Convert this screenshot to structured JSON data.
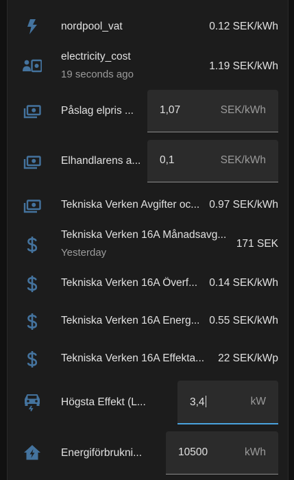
{
  "colors": {
    "background": "#111111",
    "card": "#1c1c1c",
    "icon": "#44739e",
    "field": "#2b2b2b",
    "accent": "#4aa3df"
  },
  "entities": [
    {
      "icon": "lightning-bolt-icon",
      "name": "nordpool_vat",
      "state": "0.12 SEK/kWh"
    },
    {
      "icon": "cash-user-icon",
      "name": "electricity_cost",
      "secondary": "19 seconds ago",
      "state": "1.19 SEK/kWh"
    },
    {
      "icon": "cash-icon",
      "name": "Påslag elpris ...",
      "input": {
        "value": "1,07",
        "unit": "SEK/kWh"
      }
    },
    {
      "icon": "cash-icon",
      "name": "Elhandlarens a...",
      "input": {
        "value": "0,1",
        "unit": "SEK/kWh"
      }
    },
    {
      "icon": "cash-icon",
      "name": "Tekniska Verken Avgifter oc...",
      "state": "0.97 SEK/kWh"
    },
    {
      "icon": "dollar-icon",
      "name": "Tekniska Verken 16A Månadsavg...",
      "secondary": "Yesterday",
      "state": "171 SEK"
    },
    {
      "icon": "dollar-icon",
      "name": "Tekniska Verken 16A Överf...",
      "state": "0.14 SEK/kWh"
    },
    {
      "icon": "dollar-icon",
      "name": "Tekniska Verken 16A Energ...",
      "state": "0.55 SEK/kWh"
    },
    {
      "icon": "dollar-icon",
      "name": "Tekniska Verken 16A Effekta...",
      "state": "22 SEK/kWp"
    },
    {
      "icon": "car-electric-icon",
      "name": "Högsta Effekt (L...",
      "input": {
        "value": "3,4",
        "unit": "kW"
      }
    },
    {
      "icon": "home-lightning-icon",
      "name": "Energiförbrukni...",
      "input": {
        "value": "10500",
        "unit": "kWh"
      }
    }
  ]
}
